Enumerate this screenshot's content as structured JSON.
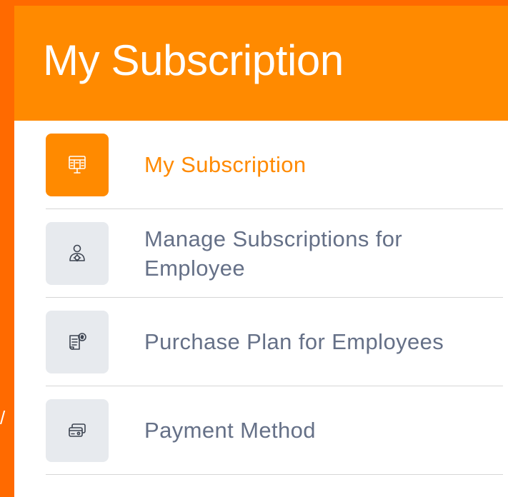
{
  "page": {
    "edge_char": "/"
  },
  "panel": {
    "title": "My Subscription"
  },
  "menu": {
    "items": [
      {
        "label": "My Subscription",
        "icon": "subscription-icon",
        "active": true
      },
      {
        "label": "Manage Subscriptions for Employee",
        "icon": "employee-settings-icon",
        "active": false
      },
      {
        "label": "Purchase Plan for Employees",
        "icon": "purchase-plan-icon",
        "active": false
      },
      {
        "label": "Payment Method",
        "icon": "payment-card-icon",
        "active": false
      }
    ]
  },
  "colors": {
    "background": "#ff6a00",
    "header": "#ff8a00",
    "accent": "#ff8a00",
    "label": "#657087",
    "icon_bg": "#e7eaee"
  }
}
